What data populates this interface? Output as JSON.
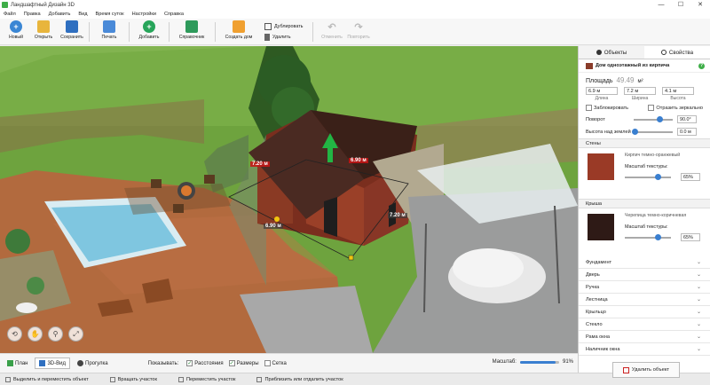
{
  "window": {
    "title": "Ландшафтный Дизайн 3D",
    "controls": [
      "—",
      "☐",
      "✕"
    ]
  },
  "menu": [
    "Файл",
    "Правка",
    "Добавить",
    "Вид",
    "Время суток",
    "Настройки",
    "Справка"
  ],
  "toolbar": {
    "new": "Новый",
    "open": "Открыть",
    "save": "Сохранить",
    "print": "Печать",
    "add": "Добавить",
    "reference": "Справочник",
    "create_house": "Создать дом",
    "duplicate": "Дублировать",
    "delete": "Удалить",
    "undo": "Отменить",
    "redo": "Повторить"
  },
  "viewport": {
    "labels": {
      "top_left": "7.20 м",
      "top_right": "6.90 м",
      "front_left": "6.90 м",
      "front_right": "7.20 м"
    }
  },
  "viewbar": {
    "tabs": [
      "План",
      "3D-Вид",
      "Прогулка"
    ],
    "show_label": "Показывать:",
    "checks": [
      {
        "label": "Расстояния",
        "checked": true
      },
      {
        "label": "Размеры",
        "checked": true
      },
      {
        "label": "Сетка",
        "checked": false
      }
    ],
    "zoom_label": "Масштаб:",
    "zoom_value": "91%",
    "zoom_fraction": 0.91
  },
  "statusbar": [
    "Выделить и переместить объект",
    "Вращать участок",
    "Переместить участок",
    "Приблизить или отдалить участок"
  ],
  "panel": {
    "tabs": [
      "Объекты",
      "Свойства"
    ],
    "object_name": "Дом одноэтажный из кирпича",
    "area_label": "Площадь",
    "area_value": "49.49",
    "area_unit": "м²",
    "dims": [
      {
        "value": "6.9 м",
        "caption": "Длина"
      },
      {
        "value": "7.2 м",
        "caption": "Ширина"
      },
      {
        "value": "4.1 м",
        "caption": "Высота"
      }
    ],
    "lock_label": "Заблокировать",
    "mirror_label": "Отразить зеркально",
    "rotation_label": "Поворот",
    "rotation_value": "90.0°",
    "height_label": "Высота над землей",
    "height_value": "0.0 м",
    "walls": {
      "title": "Стены",
      "texture": "Кирпич темно-оранжевый",
      "scale_label": "Масштаб текстуры:",
      "scale_value": "65%",
      "color": "#9a3a26"
    },
    "roof": {
      "title": "Крыша",
      "texture": "Черепица темно-коричневая",
      "scale_label": "Масштаб текстуры:",
      "scale_value": "65%",
      "color": "#2e1a16"
    },
    "sections": [
      "Фундамент",
      "Дверь",
      "Ручка",
      "Лестница",
      "Крыльцо",
      "Стекло",
      "Рама окна",
      "Наличник окна"
    ],
    "delete_button": "Удалить объект"
  }
}
